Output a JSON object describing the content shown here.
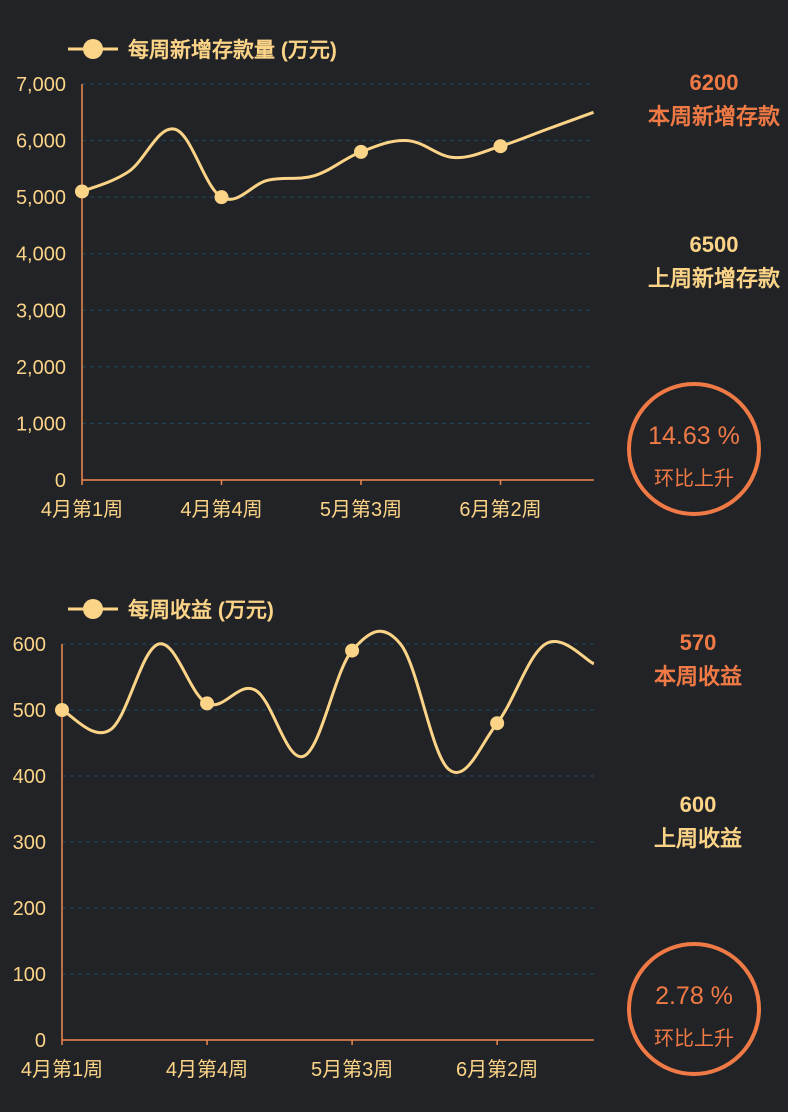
{
  "colors": {
    "background": "#212327",
    "line": "#fcd488",
    "axis": "#f0894f",
    "tick_text": "#fcd488",
    "grid": "#1f4a60",
    "accent": "#f07a45",
    "previous_value": "#fcd488"
  },
  "chart_data": [
    {
      "type": "line",
      "x_tick_labels": [
        "4月第1周",
        "4月第4周",
        "5月第3周",
        "6月第2周"
      ],
      "series": [
        {
          "name": "每周新增存款量 (万元)",
          "marker_points": [
            {
              "week_index": 0,
              "y": 5100
            },
            {
              "week_index": 3,
              "y": 5000
            },
            {
              "week_index": 6,
              "y": 5800
            },
            {
              "week_index": 9,
              "y": 5900
            }
          ],
          "curve": [
            {
              "week_index": 0,
              "y": 5100
            },
            {
              "week_index": 1,
              "y": 5450
            },
            {
              "week_index": 2,
              "y": 6200
            },
            {
              "week_index": 3,
              "y": 5000
            },
            {
              "week_index": 4,
              "y": 5300
            },
            {
              "week_index": 5,
              "y": 5380
            },
            {
              "week_index": 6,
              "y": 5800
            },
            {
              "week_index": 7,
              "y": 6000
            },
            {
              "week_index": 8,
              "y": 5700
            },
            {
              "week_index": 9,
              "y": 5900
            },
            {
              "week_index": 10,
              "y": 6200
            },
            {
              "week_index": 11,
              "y": 6500
            }
          ]
        }
      ],
      "ylim": [
        0,
        7000
      ],
      "y_ticks": [
        0,
        1000,
        2000,
        3000,
        4000,
        5000,
        6000,
        7000
      ],
      "y_tick_labels": [
        "0",
        "1,000",
        "2,000",
        "3,000",
        "4,000",
        "5,000",
        "6,000",
        "7,000"
      ],
      "grid": "horizontal dashed",
      "legend": "top-left"
    },
    {
      "type": "line",
      "x_tick_labels": [
        "4月第1周",
        "4月第4周",
        "5月第3周",
        "6月第2周"
      ],
      "series": [
        {
          "name": "每周收益 (万元)",
          "marker_points": [
            {
              "week_index": 0,
              "y": 500
            },
            {
              "week_index": 3,
              "y": 510
            },
            {
              "week_index": 6,
              "y": 590
            },
            {
              "week_index": 9,
              "y": 480
            }
          ],
          "curve": [
            {
              "week_index": 0,
              "y": 500
            },
            {
              "week_index": 1,
              "y": 470
            },
            {
              "week_index": 2,
              "y": 600
            },
            {
              "week_index": 3,
              "y": 510
            },
            {
              "week_index": 4,
              "y": 530
            },
            {
              "week_index": 5,
              "y": 430
            },
            {
              "week_index": 6,
              "y": 590
            },
            {
              "week_index": 7,
              "y": 600
            },
            {
              "week_index": 8,
              "y": 410
            },
            {
              "week_index": 9,
              "y": 480
            },
            {
              "week_index": 10,
              "y": 600
            },
            {
              "week_index": 11,
              "y": 570
            }
          ]
        }
      ],
      "ylim": [
        0,
        600
      ],
      "y_ticks": [
        0,
        100,
        200,
        300,
        400,
        500,
        600
      ],
      "y_tick_labels": [
        "0",
        "100",
        "200",
        "300",
        "400",
        "500",
        "600"
      ],
      "grid": "horizontal dashed",
      "legend": "top-left"
    }
  ],
  "panels": [
    {
      "current": {
        "value": "6200",
        "label": "本周新增存款"
      },
      "previous": {
        "value": "6500",
        "label": "上周新增存款"
      },
      "change": {
        "percent": "14.63 %",
        "label": "环比上升"
      }
    },
    {
      "current": {
        "value": "570",
        "label": "本周收益"
      },
      "previous": {
        "value": "600",
        "label": "上周收益"
      },
      "change": {
        "percent": "2.78 %",
        "label": "环比上升"
      }
    }
  ]
}
